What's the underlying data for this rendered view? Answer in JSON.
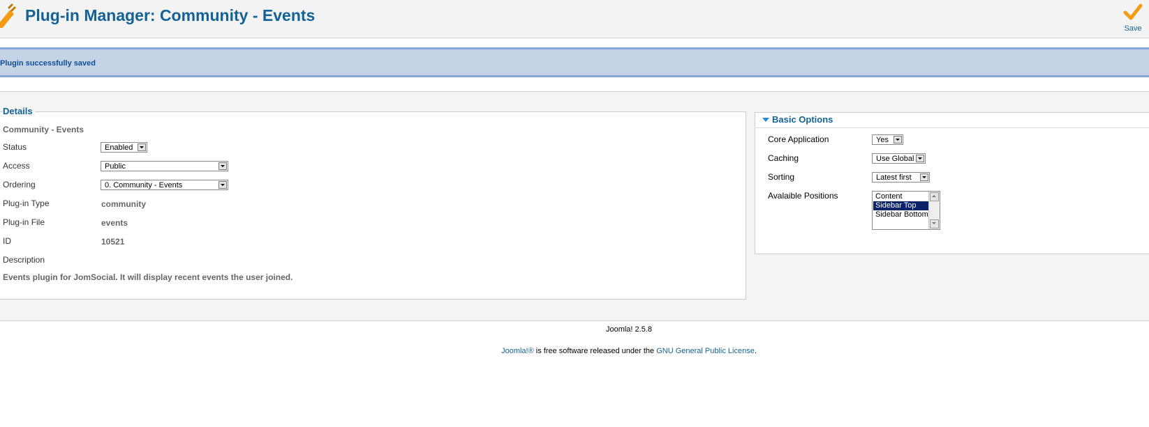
{
  "header": {
    "title": "Plug-in Manager: Community - Events",
    "save_label": "Save"
  },
  "message": "Plugin successfully saved",
  "details": {
    "legend": "Details",
    "plugin_name": "Community - Events",
    "status_label": "Status",
    "status_value": "Enabled",
    "access_label": "Access",
    "access_value": "Public",
    "ordering_label": "Ordering",
    "ordering_value": "0. Community - Events",
    "type_label": "Plug-in Type",
    "type_value": "community",
    "file_label": "Plug-in File",
    "file_value": "events",
    "id_label": "ID",
    "id_value": "10521",
    "description_label": "Description",
    "description": "Events plugin for JomSocial. It will display recent events the user joined."
  },
  "options": {
    "title": "Basic Options",
    "core_label": "Core Application",
    "core_value": "Yes",
    "caching_label": "Caching",
    "caching_value": "Use Global",
    "sorting_label": "Sorting",
    "sorting_value": "Latest first",
    "positions_label": "Avalaible Positions",
    "positions": [
      "Content",
      "Sidebar Top",
      "Sidebar Bottom"
    ],
    "selected_position": "Sidebar Top"
  },
  "footer": {
    "version": "Joomla! 2.5.8",
    "license_link": "Joomla!®",
    "license_text": " is free software released under the ",
    "gpl_link": "GNU General Public License",
    "period": "."
  },
  "colors": {
    "title_blue": "#146295",
    "message_bg": "#c5d3e6",
    "message_border": "#84a7db",
    "save_check": "#f39c12"
  }
}
